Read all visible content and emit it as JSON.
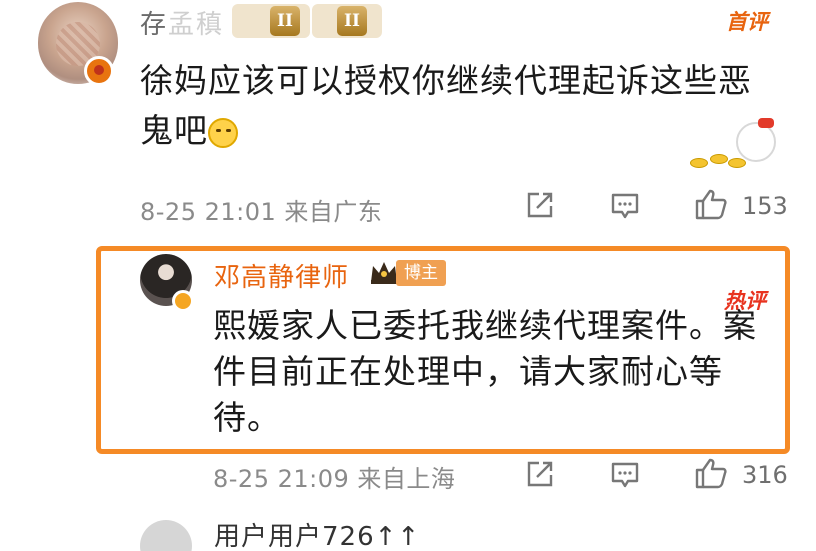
{
  "comments": [
    {
      "user": "存",
      "user_blurred": "孟稹",
      "level_badges": [
        "II",
        "II"
      ],
      "tag": "首评",
      "text": "徐妈应该可以授权你继续代理起诉这些恶鬼吧",
      "time": "8-25 21:01",
      "location": "来自广东",
      "likes": "153"
    },
    {
      "user": "邓高静律师",
      "badge": "博主",
      "tag": "热评",
      "text": "熙媛家人已委托我继续代理案件。案件目前正在处理中，请大家耐心等待。",
      "time": "8-25 21:09",
      "location": "来自上海",
      "likes": "316"
    },
    {
      "user": "用户用户726↑↑",
      "partial": true
    }
  ],
  "icons": {
    "share": "share-icon",
    "comment": "comment-icon",
    "like": "thumbs-up-icon"
  },
  "colors": {
    "accent_orange": "#f58a26",
    "hot_red": "#e8331f",
    "username_orange": "#e8640f",
    "meta_gray": "#8a8a8a"
  }
}
